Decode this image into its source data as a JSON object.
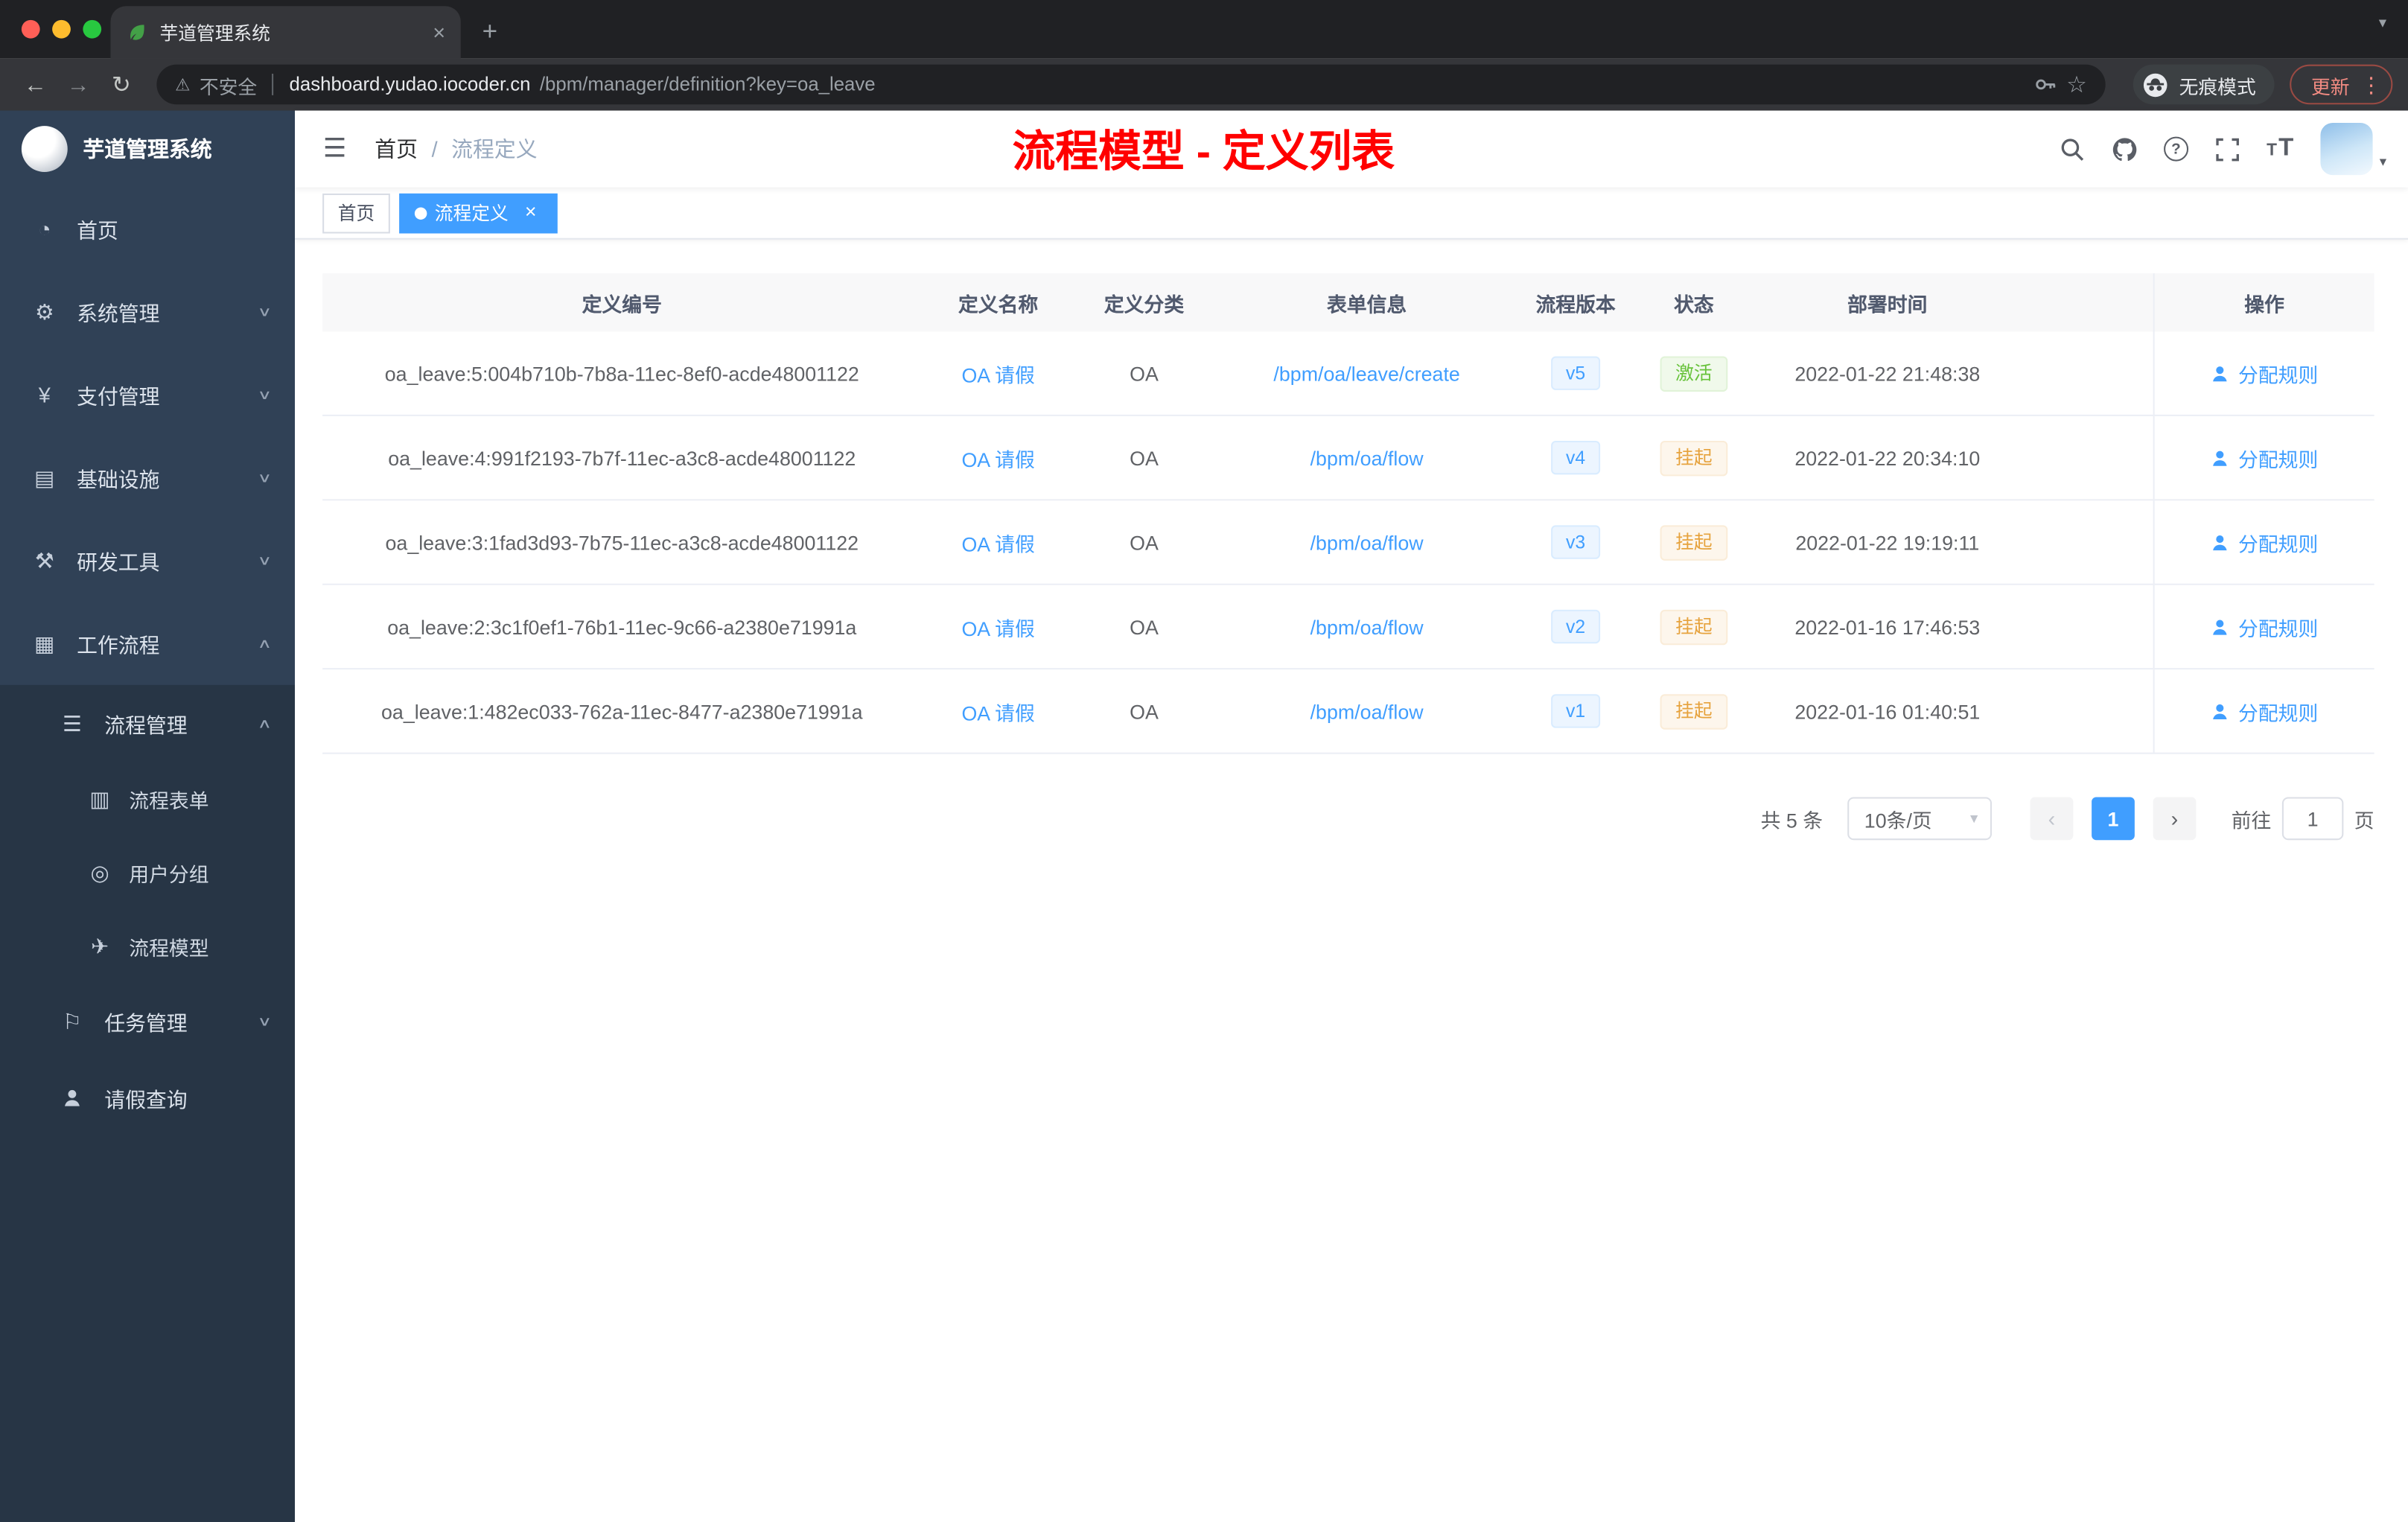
{
  "chrome": {
    "tab_title": "芋道管理系统",
    "security_label": "不安全",
    "url_host": "dashboard.yudao.iocoder.cn",
    "url_path": "/bpm/manager/definition?key=oa_leave",
    "incognito_label": "无痕模式",
    "update_label": "更新"
  },
  "sidebar": {
    "title": "芋道管理系统",
    "menu": [
      {
        "label": "首页"
      },
      {
        "label": "系统管理"
      },
      {
        "label": "支付管理"
      },
      {
        "label": "基础设施"
      },
      {
        "label": "研发工具"
      },
      {
        "label": "工作流程"
      }
    ],
    "workflow": {
      "group": {
        "label": "流程管理"
      },
      "group_children": [
        {
          "label": "流程表单"
        },
        {
          "label": "用户分组"
        },
        {
          "label": "流程模型"
        }
      ],
      "others": [
        {
          "label": "任务管理"
        },
        {
          "label": "请假查询"
        }
      ]
    }
  },
  "header": {
    "breadcrumb_home": "首页",
    "breadcrumb_sep": "/",
    "breadcrumb_current": "流程定义",
    "annotation": "流程模型 - 定义列表"
  },
  "tags": {
    "home": "首页",
    "active": "流程定义"
  },
  "table": {
    "columns": [
      "定义编号",
      "定义名称",
      "定义分类",
      "表单信息",
      "流程版本",
      "状态",
      "部署时间",
      "操作"
    ],
    "action_label": "分配规则",
    "rows": [
      {
        "id": "oa_leave:5:004b710b-7b8a-11ec-8ef0-acde48001122",
        "name": "OA 请假",
        "category": "OA",
        "form": "/bpm/oa/leave/create",
        "version": "v5",
        "status": "激活",
        "status_type": "success",
        "time": "2022-01-22 21:48:38"
      },
      {
        "id": "oa_leave:4:991f2193-7b7f-11ec-a3c8-acde48001122",
        "name": "OA 请假",
        "category": "OA",
        "form": "/bpm/oa/flow",
        "version": "v4",
        "status": "挂起",
        "status_type": "warning",
        "time": "2022-01-22 20:34:10"
      },
      {
        "id": "oa_leave:3:1fad3d93-7b75-11ec-a3c8-acde48001122",
        "name": "OA 请假",
        "category": "OA",
        "form": "/bpm/oa/flow",
        "version": "v3",
        "status": "挂起",
        "status_type": "warning",
        "time": "2022-01-22 19:19:11"
      },
      {
        "id": "oa_leave:2:3c1f0ef1-76b1-11ec-9c66-a2380e71991a",
        "name": "OA 请假",
        "category": "OA",
        "form": "/bpm/oa/flow",
        "version": "v2",
        "status": "挂起",
        "status_type": "warning",
        "time": "2022-01-16 17:46:53"
      },
      {
        "id": "oa_leave:1:482ec033-762a-11ec-8477-a2380e71991a",
        "name": "OA 请假",
        "category": "OA",
        "form": "/bpm/oa/flow",
        "version": "v1",
        "status": "挂起",
        "status_type": "warning",
        "time": "2022-01-16 01:40:51"
      }
    ]
  },
  "pagination": {
    "total": "共 5 条",
    "page_size": "10条/页",
    "current_page": "1",
    "goto_label": "前往",
    "goto_value": "1",
    "page_unit": "页"
  },
  "colors": {
    "accent": "#409eff",
    "annotation_red": "#ff0000",
    "success": "#67c23a",
    "warning": "#e6a23c",
    "sidebar_bg": "#304156",
    "submenu_bg": "#273545"
  },
  "icons": {
    "close": "×",
    "plus": "+",
    "caret_down": "▾",
    "back_arrow": "←",
    "forward_arrow": "→",
    "reload": "↻",
    "warning": "⚠",
    "star": "☆",
    "more_vertical": "⋮",
    "menu_fold": "☰",
    "dashboard": "◔",
    "gear": "⚙",
    "yen": "¥",
    "monitor": "▤",
    "tools": "⚒",
    "workflow": "▦",
    "list": "☰",
    "form": "▥",
    "users": "◎",
    "send": "✈",
    "flag": "⚐",
    "chevron_down": "∨",
    "chevron_up": "∧",
    "prev": "‹",
    "next": "›",
    "question": "?"
  }
}
